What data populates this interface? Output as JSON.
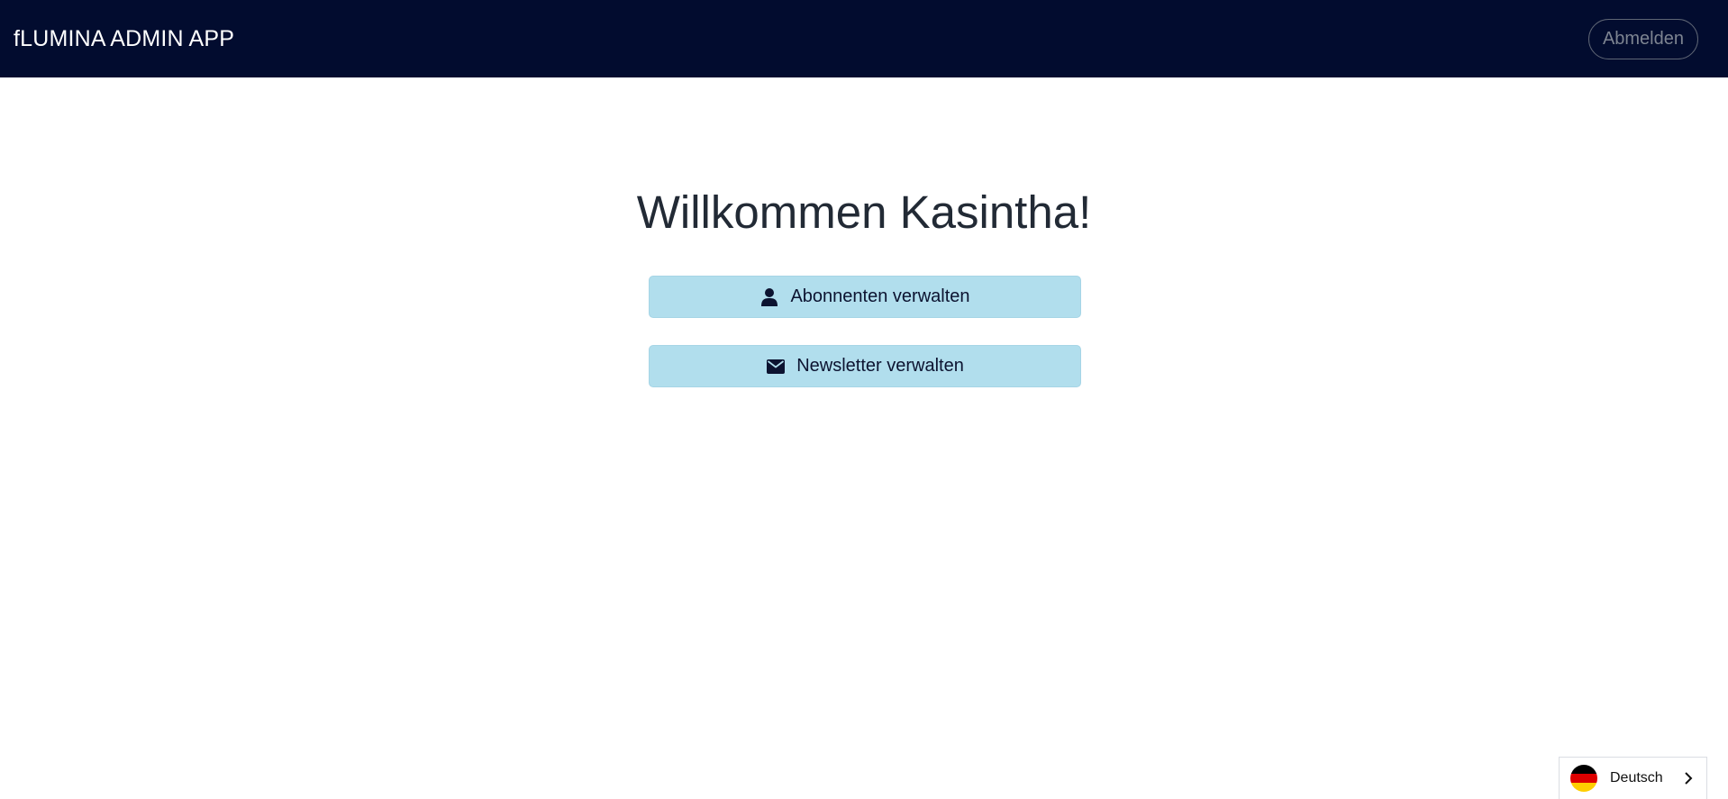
{
  "header": {
    "brand": "fLUMINA ADMIN APP",
    "logout_label": "Abmelden"
  },
  "main": {
    "welcome": "Willkommen Kasintha!",
    "actions": [
      {
        "label": "Abonnenten verwalten",
        "icon": "user-icon"
      },
      {
        "label": "Newsletter verwalten",
        "icon": "envelope-icon"
      }
    ]
  },
  "language_switcher": {
    "label": "Deutsch",
    "flag": "germany-flag-icon",
    "icon": "chevron-right-icon"
  },
  "colors": {
    "navbar_bg": "#020c2f",
    "button_bg": "#b1deed",
    "text_dark": "#222a35"
  }
}
